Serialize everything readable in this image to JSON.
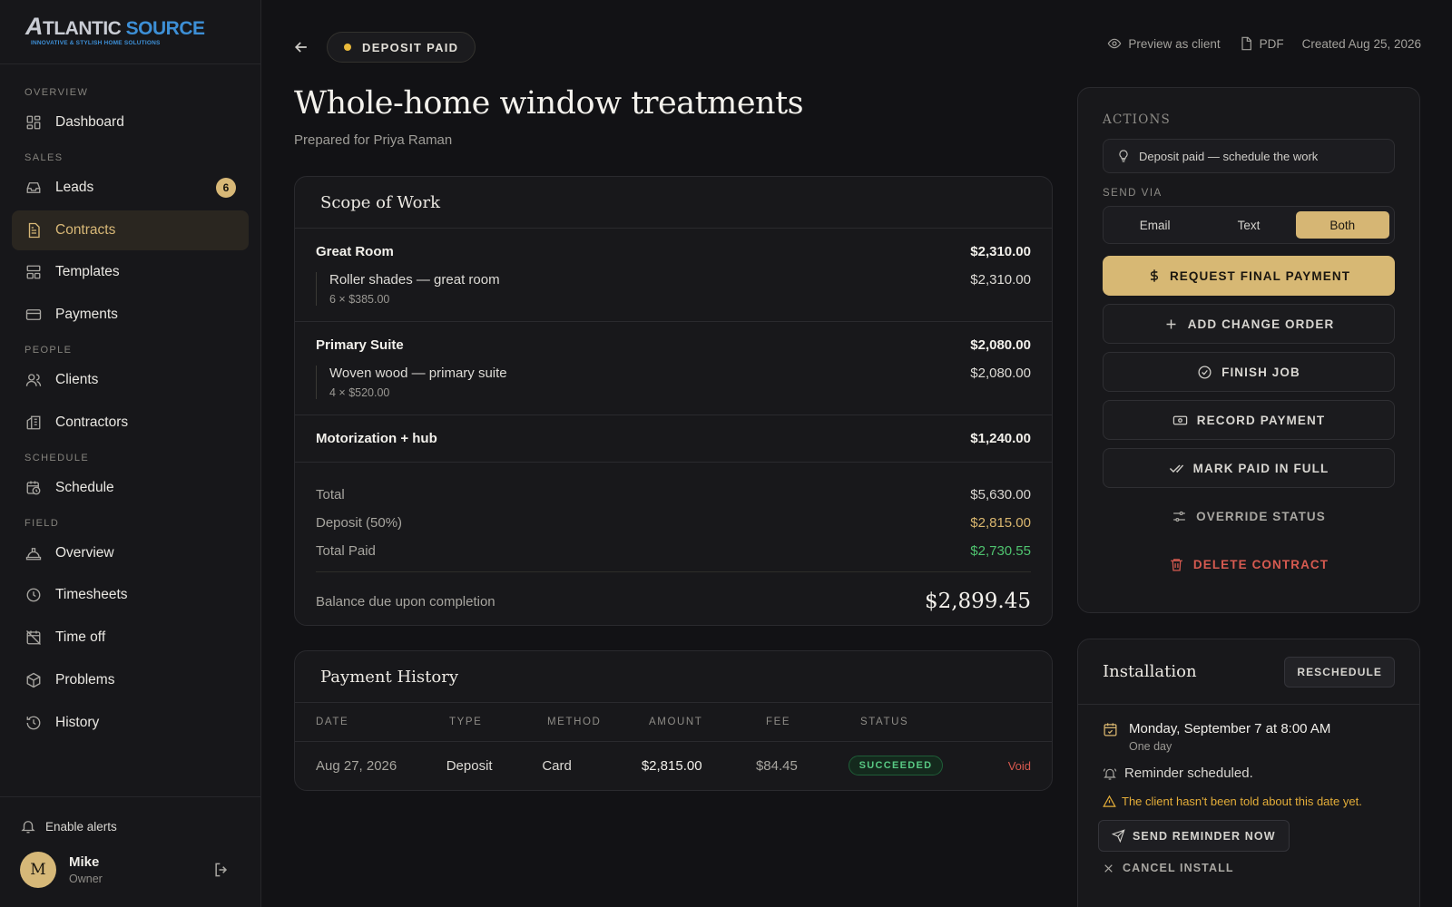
{
  "brand": {
    "logo_text_a": "A",
    "logo_text_1": "TLANTIC",
    "logo_text_2": "SOURCE",
    "logo_tagline": "INNOVATIVE & STYLISH HOME SOLUTIONS"
  },
  "sidebar": {
    "sections": {
      "overview": "OVERVIEW",
      "sales": "SALES",
      "people": "PEOPLE",
      "schedule": "SCHEDULE",
      "field": "FIELD"
    },
    "items": {
      "dashboard": "Dashboard",
      "leads": "Leads",
      "leads_count": "6",
      "contracts": "Contracts",
      "templates": "Templates",
      "payments": "Payments",
      "clients": "Clients",
      "contractors": "Contractors",
      "schedule": "Schedule",
      "field_overview": "Overview",
      "timesheets": "Timesheets",
      "time_off": "Time off",
      "problems": "Problems",
      "history": "History"
    },
    "alerts_label": "Enable alerts",
    "user": {
      "initial": "M",
      "name": "Mike",
      "role": "Owner"
    }
  },
  "topbar": {
    "status": "DEPOSIT PAID",
    "preview": "Preview as client",
    "pdf": "PDF",
    "created": "Created Aug 25, 2026"
  },
  "main": {
    "title": "Whole-home window treatments",
    "subtitle": "Prepared for Priya Raman",
    "scope": {
      "heading": "Scope of Work",
      "groups": [
        {
          "name": "Great Room",
          "total": "$2,310.00",
          "line": {
            "name": "Roller shades — great room",
            "amount": "$2,310.00",
            "detail": "6 × $385.00"
          }
        },
        {
          "name": "Primary Suite",
          "total": "$2,080.00",
          "line": {
            "name": "Woven wood — primary suite",
            "amount": "$2,080.00",
            "detail": "4 × $520.00"
          }
        },
        {
          "name": "Motorization + hub",
          "total": "$1,240.00"
        }
      ],
      "totals": {
        "total_label": "Total",
        "total": "$5,630.00",
        "deposit_label": "Deposit (50%)",
        "deposit": "$2,815.00",
        "paid_label": "Total Paid",
        "paid": "$2,730.55",
        "balance_label": "Balance due upon completion",
        "balance": "$2,899.45"
      }
    },
    "payments": {
      "heading": "Payment History",
      "columns": [
        "DATE",
        "TYPE",
        "METHOD",
        "AMOUNT",
        "FEE",
        "STATUS"
      ],
      "rows": [
        {
          "date": "Aug 27, 2026",
          "type": "Deposit",
          "method": "Card",
          "amount": "$2,815.00",
          "fee": "$84.45",
          "status": "SUCCEEDED",
          "action": "Void"
        }
      ]
    }
  },
  "actions": {
    "heading": "ACTIONS",
    "hint": "Deposit paid — schedule the work",
    "send_via_label": "SEND VIA",
    "send_options": [
      "Email",
      "Text",
      "Both"
    ],
    "send_selected": "Both",
    "request_final": "REQUEST FINAL PAYMENT",
    "add_change_order": "ADD CHANGE ORDER",
    "finish_job": "FINISH JOB",
    "record_payment": "RECORD PAYMENT",
    "mark_paid": "MARK PAID IN FULL",
    "override_status": "OVERRIDE STATUS",
    "delete_contract": "DELETE CONTRACT"
  },
  "installation": {
    "heading": "Installation",
    "reschedule": "RESCHEDULE",
    "date": "Monday, September 7 at 8:00 AM",
    "duration": "One day",
    "reminder": "Reminder scheduled.",
    "warning": "The client hasn't been told about this date yet.",
    "send_reminder": "SEND REMINDER NOW",
    "cancel_install": "CANCEL INSTALL"
  },
  "colors": {
    "accent_gold": "#d7b874",
    "success_green": "#4fc36f",
    "danger_red": "#d65a50",
    "warning_amber": "#e3ad39",
    "background": "#121215"
  }
}
